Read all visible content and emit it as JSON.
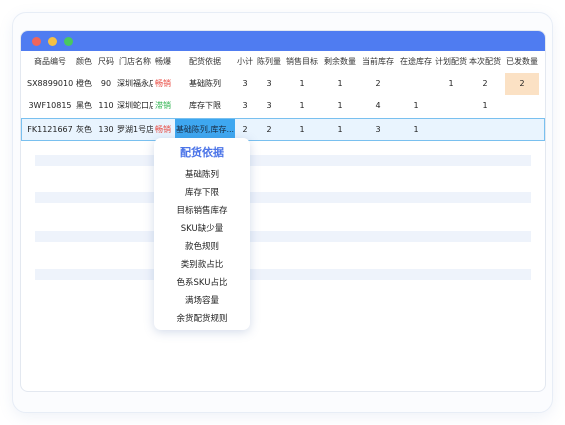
{
  "headers": [
    "商品编号",
    "颜色",
    "尺码",
    "门店名称",
    "畅爆",
    "配货依据",
    "小计",
    "陈列量",
    "销售目标",
    "剩余数量",
    "当前库存",
    "在途库存",
    "计划配货",
    "本次配货",
    "已发数量"
  ],
  "rows": [
    {
      "code": "SX8899010",
      "color": "橙色",
      "size": "90",
      "store": "深圳福永店",
      "tag": "畅销",
      "basis": "基础陈列",
      "subtotal": "3",
      "display": "3",
      "target": "1",
      "remain": "1",
      "stock": "2",
      "transit": "",
      "plan": "1",
      "current": "2",
      "shipped": "2"
    },
    {
      "code": "3WF10815",
      "color": "黑色",
      "size": "110",
      "store": "深圳蛇口店",
      "tag": "滞销",
      "basis": "库存下限",
      "subtotal": "3",
      "display": "3",
      "target": "1",
      "remain": "1",
      "stock": "4",
      "transit": "1",
      "plan": "",
      "current": "1",
      "shipped": ""
    },
    {
      "code": "FK1121667",
      "color": "灰色",
      "size": "130",
      "store": "罗湖1号店",
      "tag": "畅销",
      "basis": "基础陈列,库存...",
      "subtotal": "2",
      "display": "2",
      "target": "1",
      "remain": "1",
      "stock": "3",
      "transit": "1",
      "plan": "",
      "current": "",
      "shipped": ""
    }
  ],
  "popup": {
    "title": "配货依据",
    "items": [
      "基础陈列",
      "库存下限",
      "目标销售库存",
      "SKU缺少量",
      "款色规则",
      "类别款占比",
      "色系SKU占比",
      "满场容量",
      "余货配货规则"
    ]
  },
  "colors": {
    "accent": "#4f7cf1",
    "tag_hot": "#e8453c",
    "tag_slow": "#2bb24c",
    "selected_row": "#e9f4fe",
    "highlight_cell": "#3ea7f0",
    "shipped_highlight": "#fbe1c4"
  }
}
